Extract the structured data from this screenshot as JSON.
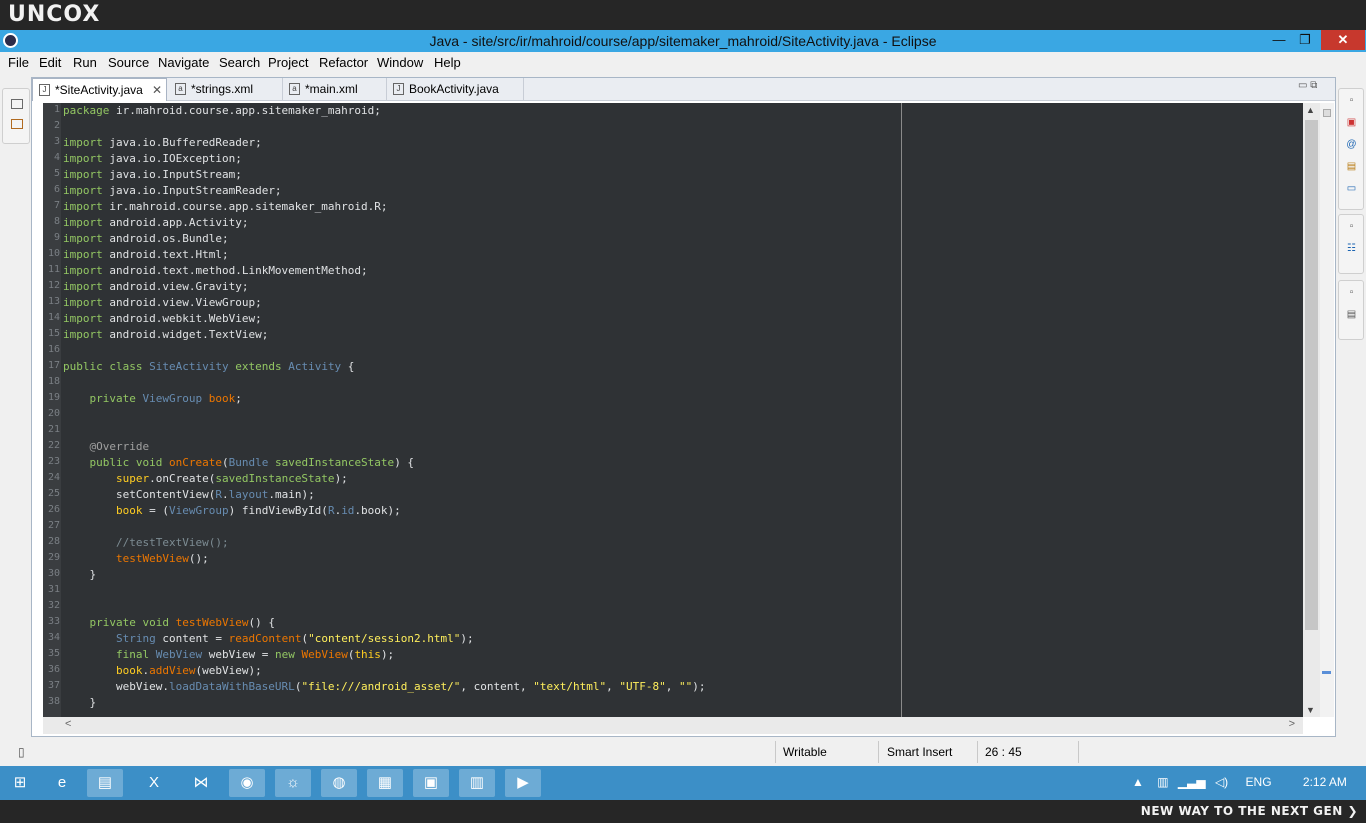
{
  "watermark": {
    "brand": "UNCOX",
    "slogan": "NEW WAY TO THE NEXT GEN ❯"
  },
  "window": {
    "title": "Java - site/src/ir/mahroid/course/app/sitemaker_mahroid/SiteActivity.java - Eclipse",
    "minimize": "—",
    "maximize": "❐",
    "close": "✕"
  },
  "menu": [
    "File",
    "Edit",
    "Run",
    "Source",
    "Navigate",
    "Search",
    "Project",
    "Refactor",
    "Window",
    "Help"
  ],
  "tabs": [
    {
      "label": "*SiteActivity.java",
      "icon": "java-file-icon",
      "glyph": "J",
      "close": "✕"
    },
    {
      "label": "*strings.xml",
      "icon": "xml-file-icon",
      "glyph": "a"
    },
    {
      "label": "*main.xml",
      "icon": "xml-file-icon",
      "glyph": "a"
    },
    {
      "label": "BookActivity.java",
      "icon": "java-file-icon",
      "glyph": "J"
    }
  ],
  "tab_controls": "▭ ⧉",
  "editor": {
    "current_line": 20,
    "lines": [
      {
        "n": "1",
        "html": "<span class='k'>package</span> ir.mahroid.course.app.sitemaker_mahroid;"
      },
      {
        "n": "2",
        "html": ""
      },
      {
        "n": "3",
        "html": "<span class='k'>import</span> java.io.BufferedReader;"
      },
      {
        "n": "4",
        "html": "<span class='k'>import</span> java.io.IOException;"
      },
      {
        "n": "5",
        "html": "<span class='k'>import</span> java.io.InputStream;"
      },
      {
        "n": "6",
        "html": "<span class='k'>import</span> java.io.InputStreamReader;"
      },
      {
        "n": "7",
        "html": "<span class='k'>import</span> ir.mahroid.course.app.sitemaker_mahroid.R;"
      },
      {
        "n": "8",
        "html": "<span class='k'>import</span> android.app.Activity;"
      },
      {
        "n": "9",
        "html": "<span class='k'>import</span> android.os.Bundle;"
      },
      {
        "n": "10",
        "html": "<span class='k'>import</span> android.text.Html;"
      },
      {
        "n": "11",
        "html": "<span class='k'>import</span> android.text.method.LinkMovementMethod;"
      },
      {
        "n": "12",
        "html": "<span class='k'>import</span> android.view.Gravity;"
      },
      {
        "n": "13",
        "html": "<span class='k'>import</span> android.view.ViewGroup;"
      },
      {
        "n": "14",
        "html": "<span class='k'>import</span> android.webkit.WebView;"
      },
      {
        "n": "15",
        "html": "<span class='k'>import</span> android.widget.TextView;"
      },
      {
        "n": "16",
        "html": ""
      },
      {
        "n": "17",
        "html": "<span class='k'>public class</span> <span class='t'>SiteActivity</span> <span class='k'>extends</span> <span class='t'>Activity</span> {"
      },
      {
        "n": "18",
        "html": ""
      },
      {
        "n": "19",
        "html": "    <span class='k'>private</span> <span class='t'>ViewGroup</span> <span class='s'>book</span>;"
      },
      {
        "n": "20",
        "html": ""
      },
      {
        "n": "21",
        "html": ""
      },
      {
        "n": "22",
        "html": "    <span class='ann'>@Override</span>"
      },
      {
        "n": "23",
        "html": "    <span class='k'>public void</span> <span class='s'>onCreate</span>(<span class='t'>Bundle</span> <span class='k'>savedInstanceState</span>) {"
      },
      {
        "n": "24",
        "html": "        <span class='v'>super</span>.onCreate(<span class='k'>savedInstanceState</span>);"
      },
      {
        "n": "25",
        "html": "        setContentView(<span class='t'>R</span>.<span class='t'>layout</span>.main);"
      },
      {
        "n": "26",
        "html": "        <span class='v'>book</span> = (<span class='t'>ViewGroup</span>) findViewById(<span class='t'>R</span>.<span class='t'>id</span>.book);"
      },
      {
        "n": "27",
        "html": ""
      },
      {
        "n": "28",
        "html": "        <span class='c'>//testTextView();</span>"
      },
      {
        "n": "29",
        "html": "        <span class='s'>testWebView</span>();"
      },
      {
        "n": "30",
        "html": "    }"
      },
      {
        "n": "31",
        "html": ""
      },
      {
        "n": "32",
        "html": ""
      },
      {
        "n": "33",
        "html": "    <span class='k'>private void</span> <span class='s'>testWebView</span>() {"
      },
      {
        "n": "34",
        "html": "        <span class='t'>String</span> content = <span class='s'>readContent</span>(<span class='str'>\"content/session2.html\"</span>);"
      },
      {
        "n": "35",
        "html": "        <span class='k'>final</span> <span class='t'>WebView</span> webView = <span class='k'>new</span> <span class='s'>WebView</span>(<span class='v'>this</span>);"
      },
      {
        "n": "36",
        "html": "        <span class='v'>book</span>.<span class='s'>addView</span>(webView);"
      },
      {
        "n": "37",
        "html": "        webView.<span class='t'>loadDataWithBaseURL</span>(<span class='str'>\"file:///android_asset/\"</span>, content, <span class='str'>\"text/html\"</span>, <span class='str'>\"UTF-8\"</span>, <span class='str'>\"\"</span>);"
      },
      {
        "n": "38",
        "html": "    }"
      }
    ]
  },
  "scroll": {
    "up": "▲",
    "down": "▼",
    "left": "<",
    "right": ">"
  },
  "status": {
    "mode": "Writable",
    "insert": "Smart Insert",
    "position": "26 : 45"
  },
  "taskbar": {
    "apps": [
      {
        "name": "start-button",
        "glyph": "⊞"
      },
      {
        "name": "internet-explorer-icon",
        "glyph": "e"
      },
      {
        "name": "file-explorer-icon",
        "glyph": "▤"
      },
      {
        "name": "excel-icon",
        "glyph": "X"
      },
      {
        "name": "visual-studio-icon",
        "glyph": "⋈"
      },
      {
        "name": "firefox-icon",
        "glyph": "◉"
      },
      {
        "name": "eclipse-icon",
        "glyph": "☼"
      },
      {
        "name": "globe-app-icon",
        "glyph": "◍"
      },
      {
        "name": "notepad-icon",
        "glyph": "▦"
      },
      {
        "name": "remote-desktop-icon",
        "glyph": "▣"
      },
      {
        "name": "winrar-icon",
        "glyph": "▥"
      },
      {
        "name": "media-player-icon",
        "glyph": "▶"
      }
    ],
    "tray": {
      "lang": "ENG",
      "time": "2:12 AM"
    }
  },
  "colors": {
    "accent": "#3aa7e3",
    "editor_bg": "#2f3235",
    "taskbar": "#3c8fc7",
    "close": "#c7382d"
  }
}
